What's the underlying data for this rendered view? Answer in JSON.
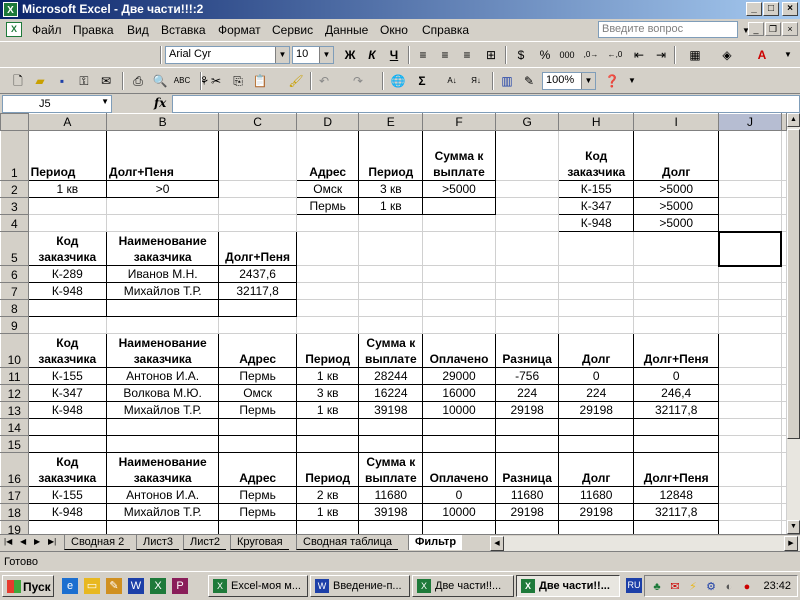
{
  "window": {
    "title": "Microsoft Excel - Две части!!!:2"
  },
  "menu": {
    "items": [
      "Файл",
      "Правка",
      "Вид",
      "Вставка",
      "Формат",
      "Сервис",
      "Данные",
      "Окно",
      "Справка"
    ],
    "help_placeholder": "Введите вопрос"
  },
  "toolbar": {
    "font_name": "Arial Cyr",
    "font_size": "10",
    "bold": "Ж",
    "italic": "К",
    "underline": "Ч",
    "zoom": "100%"
  },
  "formula_bar": {
    "name_box": "J5",
    "fx": "fx",
    "formula": ""
  },
  "grid": {
    "selected_cell": "J5",
    "columns": [
      "A",
      "B",
      "C",
      "D",
      "E",
      "F",
      "G",
      "H",
      "I",
      "J"
    ],
    "row_numbers": [
      "1",
      "2",
      "3",
      "4",
      "5",
      "6",
      "7",
      "8",
      "9",
      "10",
      "11",
      "12",
      "13",
      "14",
      "15",
      "16",
      "17",
      "18",
      "19"
    ],
    "rows": {
      "1": [
        "Период",
        "Долг+Пеня",
        "",
        "Адрес",
        "Период",
        "Сумма к выплате",
        "",
        "Код заказчика",
        "Долг",
        ""
      ],
      "2": [
        "1 кв",
        ">0",
        "",
        "Омск",
        "3 кв",
        ">5000",
        "",
        "К-155",
        ">5000",
        ""
      ],
      "3": [
        "",
        "",
        "",
        "Пермь",
        "1 кв",
        "",
        "",
        "К-347",
        ">5000",
        ""
      ],
      "4": [
        "",
        "",
        "",
        "",
        "",
        "",
        "",
        "К-948",
        ">5000",
        ""
      ],
      "5": [
        "Код заказчика",
        "Наименование заказчика",
        "Долг+Пеня",
        "",
        "",
        "",
        "",
        "",
        "",
        ""
      ],
      "6": [
        "К-289",
        "Иванов М.Н.",
        "2437,6",
        "",
        "",
        "",
        "",
        "",
        "",
        ""
      ],
      "7": [
        "К-948",
        "Михайлов Т.Р.",
        "32117,8",
        "",
        "",
        "",
        "",
        "",
        "",
        ""
      ],
      "8": [
        "",
        "",
        "",
        "",
        "",
        "",
        "",
        "",
        "",
        ""
      ],
      "9": [
        "",
        "",
        "",
        "",
        "",
        "",
        "",
        "",
        "",
        ""
      ],
      "10": [
        "Код заказчика",
        "Наименование заказчика",
        "Адрес",
        "Период",
        "Сумма к выплате",
        "Оплачено",
        "Разница",
        "Долг",
        "Долг+Пеня",
        ""
      ],
      "11": [
        "К-155",
        "Антонов И.А.",
        "Пермь",
        "1 кв",
        "28244",
        "29000",
        "-756",
        "0",
        "0",
        ""
      ],
      "12": [
        "К-347",
        "Волкова М.Ю.",
        "Омск",
        "3 кв",
        "16224",
        "16000",
        "224",
        "224",
        "246,4",
        ""
      ],
      "13": [
        "К-948",
        "Михайлов Т.Р.",
        "Пермь",
        "1 кв",
        "39198",
        "10000",
        "29198",
        "29198",
        "32117,8",
        ""
      ],
      "14": [
        "",
        "",
        "",
        "",
        "",
        "",
        "",
        "",
        "",
        ""
      ],
      "15": [
        "",
        "",
        "",
        "",
        "",
        "",
        "",
        "",
        "",
        ""
      ],
      "16": [
        "Код заказчика",
        "Наименование заказчика",
        "Адрес",
        "Период",
        "Сумма к выплате",
        "Оплачено",
        "Разница",
        "Долг",
        "Долг+Пеня",
        ""
      ],
      "17": [
        "К-155",
        "Антонов И.А.",
        "Пермь",
        "2 кв",
        "11680",
        "0",
        "11680",
        "11680",
        "12848",
        ""
      ],
      "18": [
        "К-948",
        "Михайлов Т.Р.",
        "Пермь",
        "1 кв",
        "39198",
        "10000",
        "29198",
        "29198",
        "32117,8",
        ""
      ],
      "19": [
        "",
        "",
        "",
        "",
        "",
        "",
        "",
        "",
        "",
        ""
      ]
    }
  },
  "sheets": {
    "tabs": [
      "Сводная 2",
      "Лист3",
      "Лист2",
      "Круговая",
      "Сводная таблица",
      "Фильтр"
    ],
    "active": "Фильтр"
  },
  "status": {
    "text": "Готово"
  },
  "taskbar": {
    "start_label": "Пуск",
    "tasks": [
      "Excel-моя м...",
      "Введение-п...",
      "Две части!!...",
      "Две части!!..."
    ],
    "active_task": 3,
    "lang": "RU",
    "clock": "23:42"
  }
}
